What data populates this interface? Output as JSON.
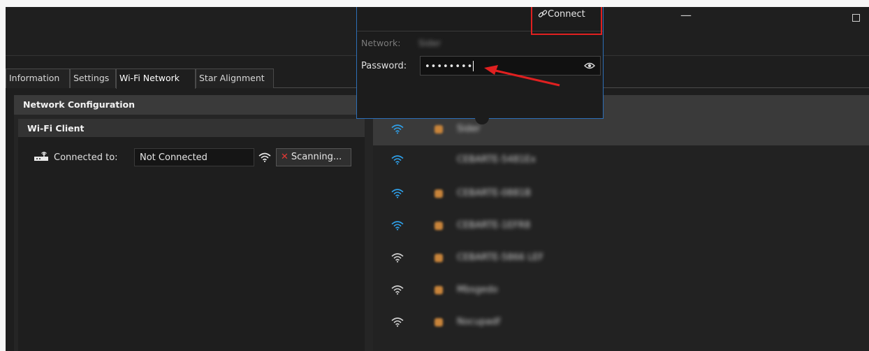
{
  "window": {
    "minimize": "—"
  },
  "tabs": [
    {
      "label": "Information"
    },
    {
      "label": "Settings"
    },
    {
      "label": "Wi-Fi Network"
    },
    {
      "label": "Star Alignment"
    }
  ],
  "network_config": {
    "title": "Network Configuration",
    "wifi_client": {
      "title": "Wi-Fi Client",
      "connected_label": "Connected to:",
      "connected_value": "Not Connected",
      "scan_label": "Scanning..."
    }
  },
  "networks": [
    {
      "name": "Sider",
      "locked": true,
      "selected": true
    },
    {
      "name": "CEBARTE-5481Ex",
      "locked": false,
      "selected": false
    },
    {
      "name": "CEBARTE-0881B",
      "locked": true,
      "selected": false
    },
    {
      "name": "CEBARTE-1EFR8",
      "locked": true,
      "selected": false
    },
    {
      "name": "CEBARTE-5866 LEF",
      "locked": true,
      "selected": false
    },
    {
      "name": "Mbsgedo",
      "locked": true,
      "selected": false
    },
    {
      "name": "Nocupadf",
      "locked": true,
      "selected": false
    }
  ],
  "popup": {
    "connect_label": "Connect",
    "network_label": "Network:",
    "network_value": "Sider",
    "password_label": "Password:",
    "password_mask": "••••••••"
  },
  "colors": {
    "wifi_blue": "#2f9fe8",
    "highlight_red": "#e02020",
    "popup_border": "#2d6fb8"
  }
}
